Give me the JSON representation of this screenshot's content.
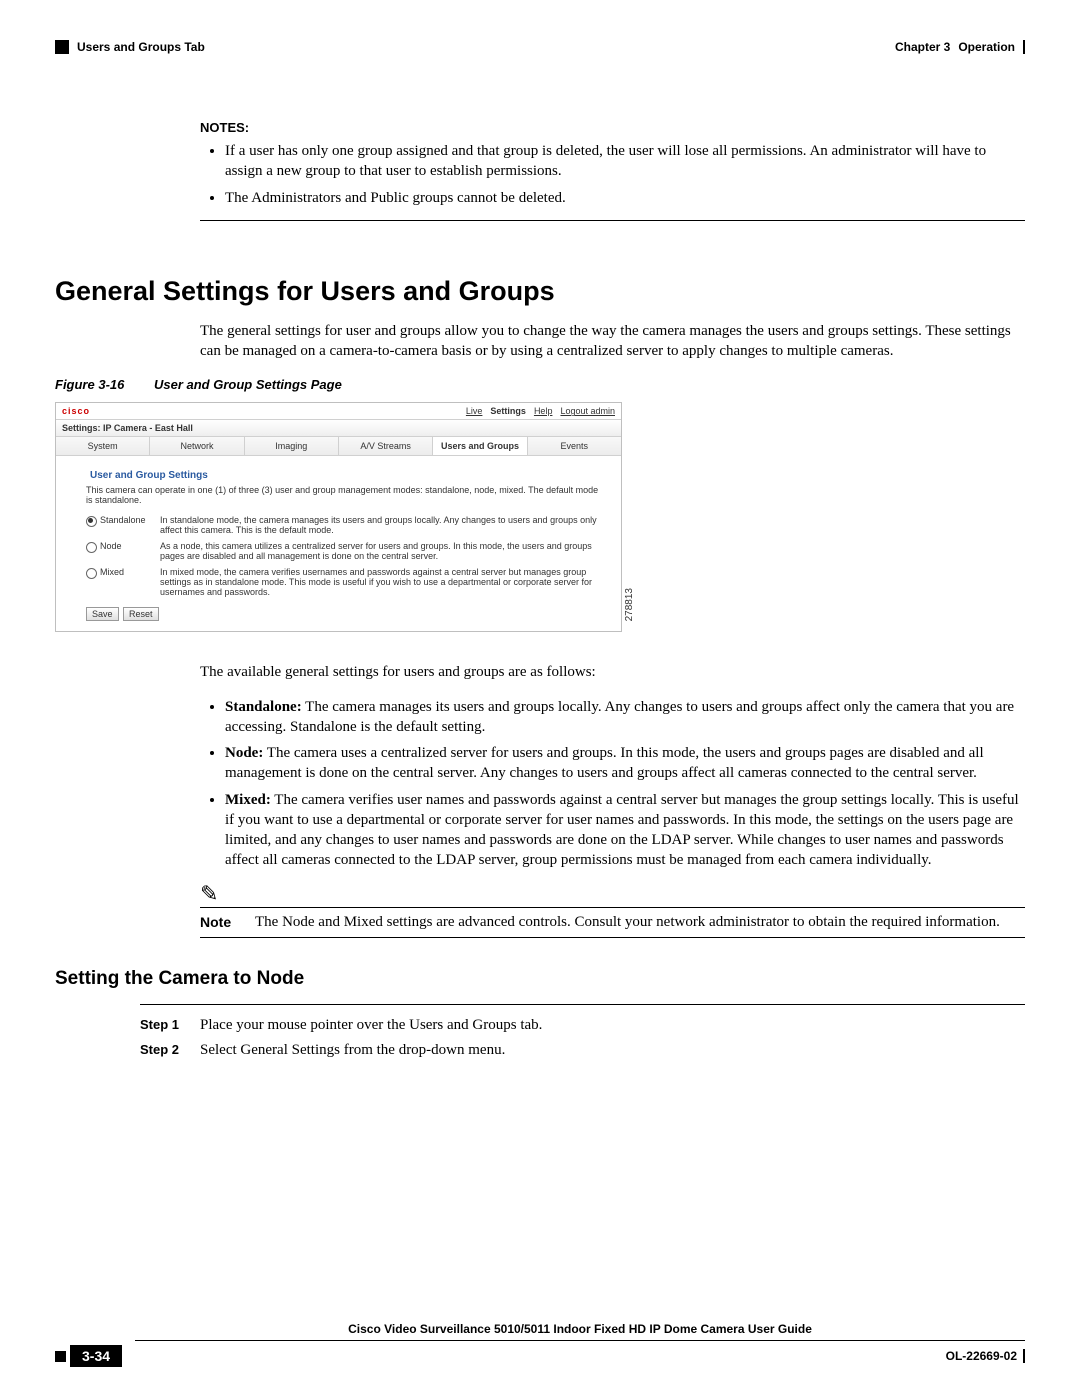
{
  "header": {
    "left": "Users and Groups Tab",
    "chapter": "Chapter 3",
    "title": "Operation"
  },
  "notes": {
    "label": "NOTES:",
    "items": [
      "If a user has only one group assigned and that group is deleted, the user will lose all permissions. An administrator will have to assign a new group to that user to establish permissions.",
      "The Administrators and Public groups cannot be deleted."
    ]
  },
  "section": {
    "heading": "General Settings for Users and Groups",
    "intro": "The general settings for user and groups allow you to change the way the camera manages the users and groups settings. These settings can be managed on a camera-to-camera basis or by using a centralized server to apply changes to multiple cameras."
  },
  "figure": {
    "num": "Figure 3-16",
    "title": "User and Group Settings Page",
    "logo": "cisco",
    "nav": {
      "live": "Live",
      "settings": "Settings",
      "help": "Help",
      "logout": "Logout admin"
    },
    "breadcrumb": "Settings: IP Camera - East Hall",
    "tabs": {
      "system": "System",
      "network": "Network",
      "imaging": "Imaging",
      "av": "A/V Streams",
      "users": "Users and Groups",
      "events": "Events"
    },
    "fieldset": "User and Group Settings",
    "intro": "This camera can operate in one (1) of three (3) user and group management modes: standalone, node, mixed. The default mode is standalone.",
    "modes": {
      "standalone": {
        "label": "Standalone",
        "desc": "In standalone mode, the camera manages its users and groups locally. Any changes to users and groups only affect this camera. This is the default mode."
      },
      "node": {
        "label": "Node",
        "desc": "As a node, this camera utilizes a centralized server for users and groups. In this mode, the users and groups pages are disabled and all management is done on the central server."
      },
      "mixed": {
        "label": "Mixed",
        "desc": "In mixed mode, the camera verifies usernames and passwords against a central server but manages group settings as in standalone mode. This mode is useful if you wish to use a departmental or corporate server for usernames and passwords."
      }
    },
    "buttons": {
      "save": "Save",
      "reset": "Reset"
    },
    "side_id": "278813"
  },
  "available": {
    "intro": "The available general settings for users and groups are as follows:",
    "items": {
      "standalone": {
        "label": "Standalone:",
        "text": " The camera manages its users and groups locally. Any changes to users and groups affect only the camera that you are accessing. Standalone is the default setting."
      },
      "node": {
        "label": "Node:",
        "text": " The camera uses a centralized server for users and groups. In this mode, the users and groups pages are disabled and all management is done on the central server. Any changes to users and groups affect all cameras connected to the central server."
      },
      "mixed": {
        "label": "Mixed:",
        "text": " The camera verifies user names and passwords against a central server but manages the group settings locally. This is useful if you want to use a departmental or corporate server for user names and passwords. In this mode, the settings on the users page are limited, and any changes to user names and passwords are done on the LDAP server. While changes to user names and passwords affect all cameras connected to the LDAP server, group permissions must be managed from each camera individually."
      }
    }
  },
  "note": {
    "label": "Note",
    "text": "The Node and Mixed settings are advanced controls. Consult your network administrator to obtain the required information."
  },
  "subsection": {
    "heading": "Setting the Camera to Node",
    "steps": {
      "s1": {
        "label": "Step 1",
        "text": "Place your mouse pointer over the Users and Groups tab."
      },
      "s2": {
        "label": "Step 2",
        "text": "Select General Settings from the drop-down menu."
      }
    }
  },
  "footer": {
    "title": "Cisco Video Surveillance 5010/5011 Indoor Fixed HD IP Dome Camera User Guide",
    "page": "3-34",
    "doc": "OL-22669-02"
  }
}
